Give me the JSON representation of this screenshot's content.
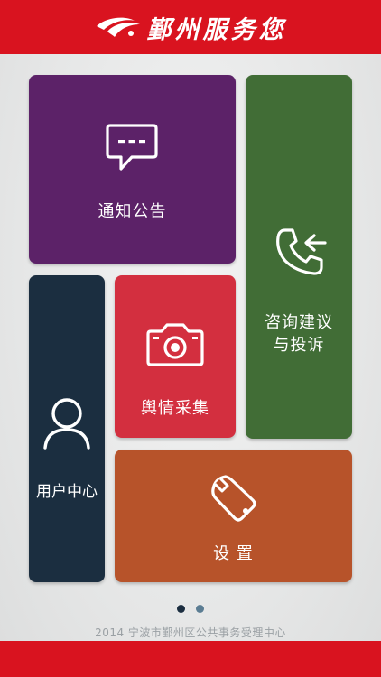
{
  "header": {
    "title": "鄞州服务您"
  },
  "tiles": {
    "notice": {
      "label": "通知公告",
      "icon": "chat-bubble-icon",
      "color": "#5c2268"
    },
    "consult": {
      "label_line1": "咨询建议",
      "label_line2": "与投诉",
      "icon": "phone-callback-icon",
      "color": "#416d36"
    },
    "user": {
      "label": "用户中心",
      "icon": "user-icon",
      "color": "#1b2e40"
    },
    "opinion": {
      "label": "舆情采集",
      "icon": "camera-icon",
      "color": "#d32f3f"
    },
    "settings": {
      "label": "设 置",
      "icon": "wrench-icon",
      "color": "#b7532a"
    }
  },
  "pager": {
    "pages": 2,
    "current": 1
  },
  "footer": {
    "text": "2014 宁波市鄞州区公共事务受理中心"
  },
  "colors": {
    "brand_red": "#d9131f"
  }
}
